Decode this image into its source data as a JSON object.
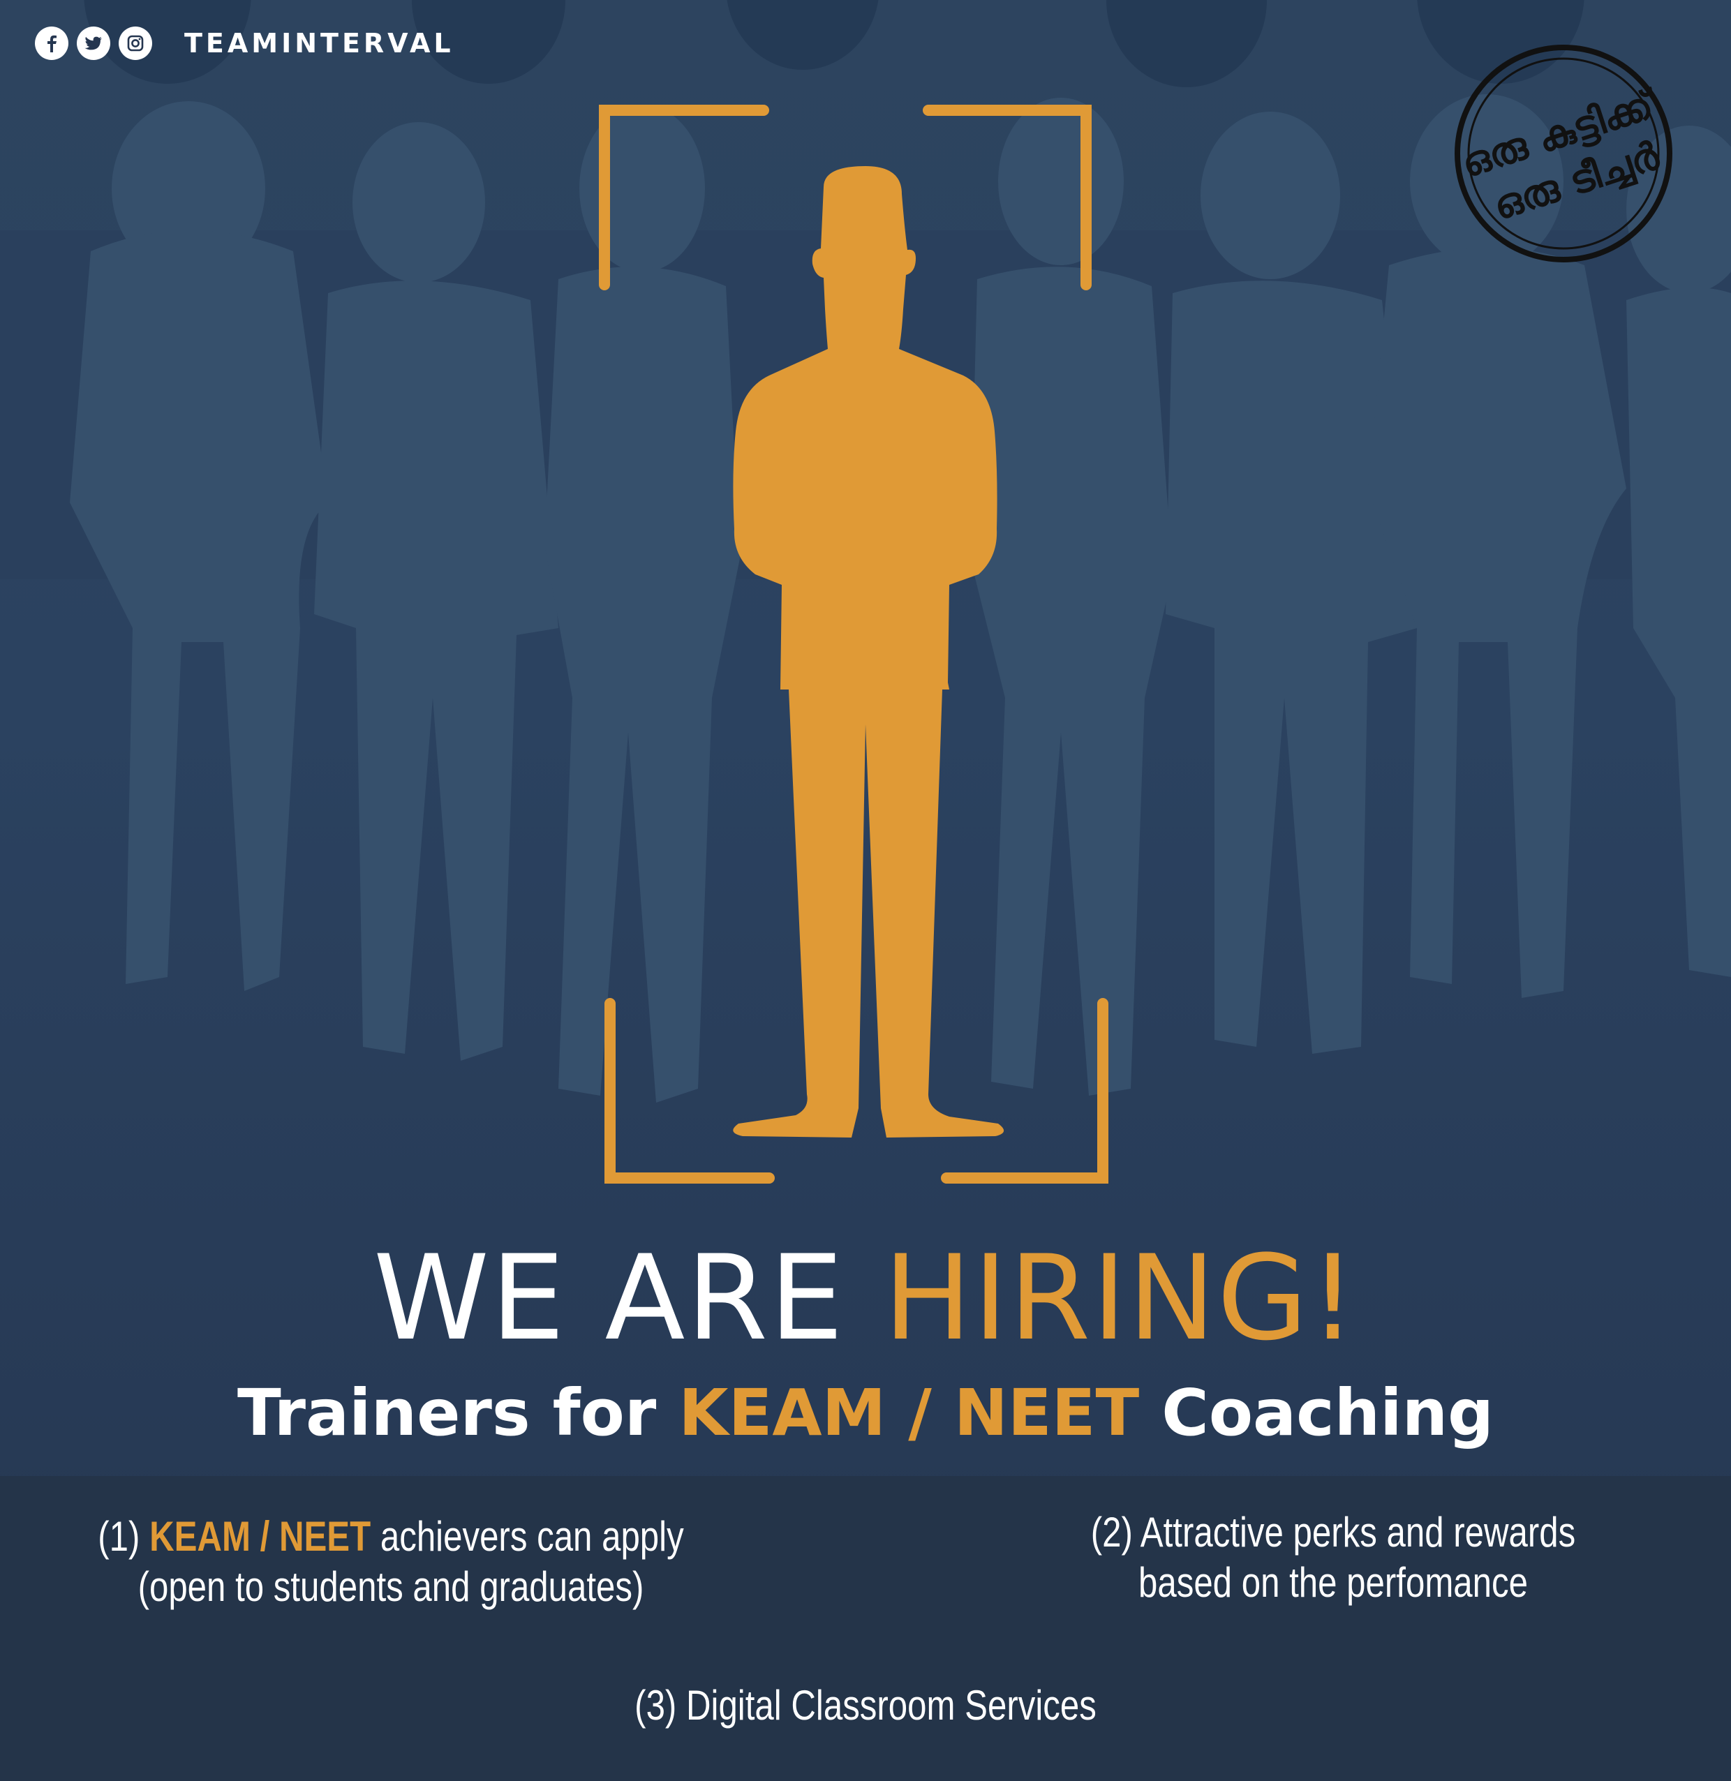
{
  "header": {
    "brand": "TEAMINTERVAL",
    "social_icons": [
      "facebook-icon",
      "twitter-icon",
      "instagram-icon"
    ]
  },
  "stamp": {
    "line1": "ഒരു കുട്ടിക്ക്",
    "line2": "ഒരു ടീച്ചർ"
  },
  "headline": {
    "part1": "WE ARE ",
    "part2": "HIRING!"
  },
  "subheadline": {
    "prefix": "Trainers for ",
    "highlight": "KEAM / NEET",
    "suffix": " Coaching"
  },
  "points": [
    {
      "num": "(1) ",
      "highlight": "KEAM / NEET",
      "text": " achievers can apply",
      "line2": "(open to students and graduates)"
    },
    {
      "line1": "(2) Attractive perks and rewards",
      "line2": "based on the perfomance"
    },
    {
      "line1": "(3) Digital Classroom Services"
    }
  ],
  "colors": {
    "accent": "#e09a36",
    "background": "#2b4260",
    "crowd": "#36506c",
    "text": "#ffffff",
    "stamp": "#111111"
  }
}
